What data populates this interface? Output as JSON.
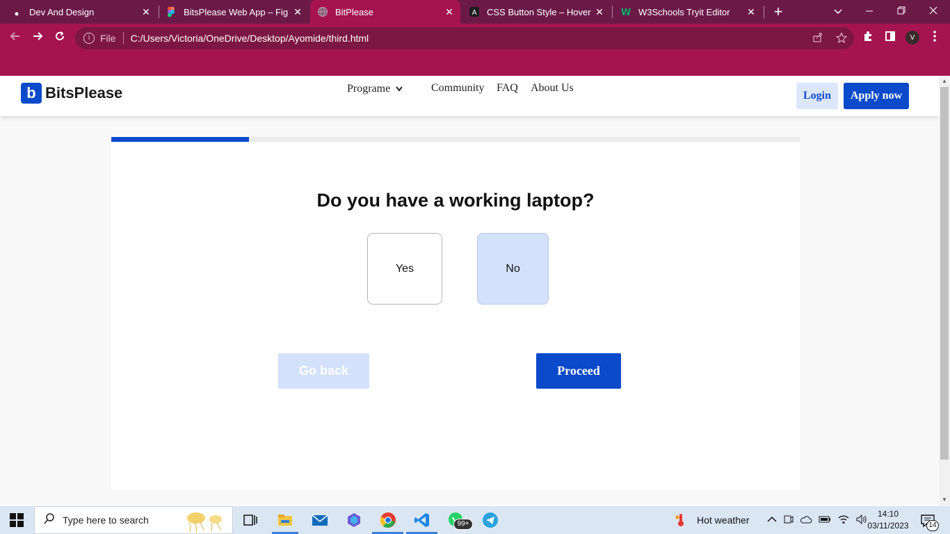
{
  "browser": {
    "tabs": [
      {
        "label": "Dev And Design",
        "icon": "dot-icon"
      },
      {
        "label": "BitsPlease Web App – Figma",
        "icon": "figma-icon"
      },
      {
        "label": "BitPlease",
        "icon": "globe-icon",
        "active": true
      },
      {
        "label": "CSS Button Style – Hover, Co",
        "icon": "angular-icon"
      },
      {
        "label": "W3Schools Tryit Editor",
        "icon": "w3schools-icon"
      }
    ],
    "close_glyph": "✕",
    "new_tab_glyph": "+",
    "address": {
      "scheme_label": "File",
      "url": "C:/Users/Victoria/OneDrive/Desktop/Ayomide/third.html"
    },
    "profile_initial": "V"
  },
  "site": {
    "brand": "BitsPlease",
    "logo_letter": "b",
    "nav": {
      "programe": "Programe",
      "community": "Community",
      "faq": "FAQ",
      "about": "About Us"
    },
    "login": "Login",
    "apply": "Apply now"
  },
  "quiz": {
    "progress": 0.2,
    "question": "Do you have a working laptop?",
    "options": {
      "yes": "Yes",
      "no": "No"
    },
    "selected": "No",
    "back": "Go back",
    "proceed": "Proceed"
  },
  "taskbar": {
    "search_placeholder": "Type here to search",
    "whatsapp_badge": "99+",
    "weather": "Hot weather",
    "time": "14:10",
    "date": "03/11/2023",
    "notifications": "14"
  },
  "colors": {
    "brand_blue": "#0a4acb",
    "light_blue": "#d3e1fb",
    "chrome": "#a51451"
  }
}
